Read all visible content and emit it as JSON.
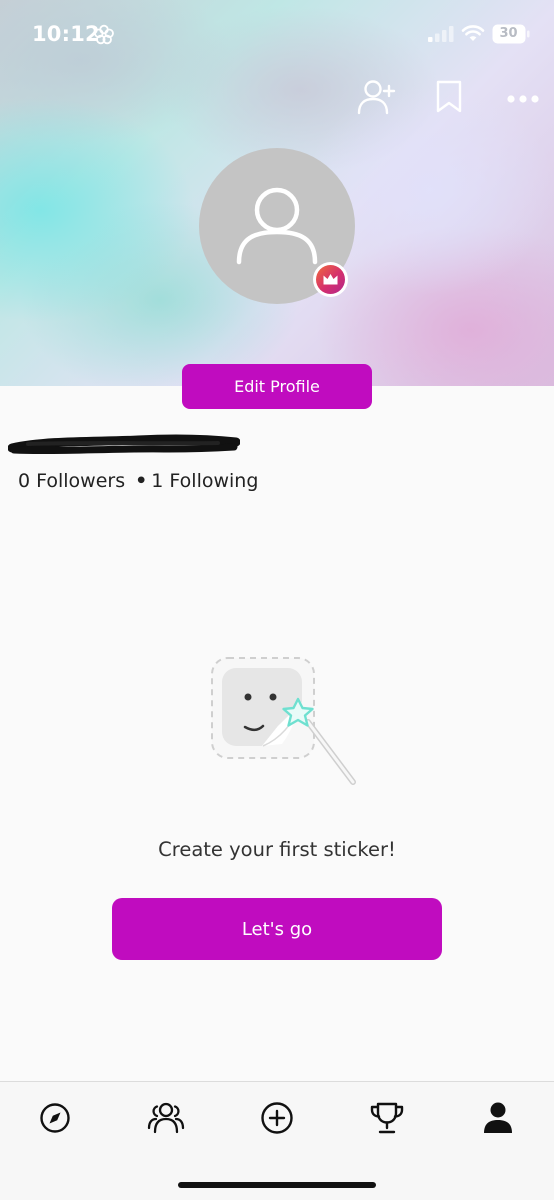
{
  "status_bar": {
    "time": "10:12",
    "battery": "30",
    "icons": [
      "flower-icon",
      "signal-icon",
      "wifi-icon",
      "battery-icon"
    ]
  },
  "header_actions": [
    "add-friend-icon",
    "bookmark-icon",
    "more-icon"
  ],
  "profile": {
    "edit_label": "Edit Profile",
    "followers": "0 Followers",
    "separator": "•",
    "following": "1 Following"
  },
  "empty_state": {
    "message": "Create your first sticker!",
    "cta_label": "Let's go"
  },
  "tab_bar": {
    "items": [
      "explore",
      "community",
      "create",
      "leaderboard",
      "profile"
    ],
    "active": "profile"
  },
  "colors": {
    "accent": "#c00cbf",
    "badge_start": "#f06a3c",
    "badge_end": "#b2278d",
    "wand_star": "#6fe0d0"
  }
}
